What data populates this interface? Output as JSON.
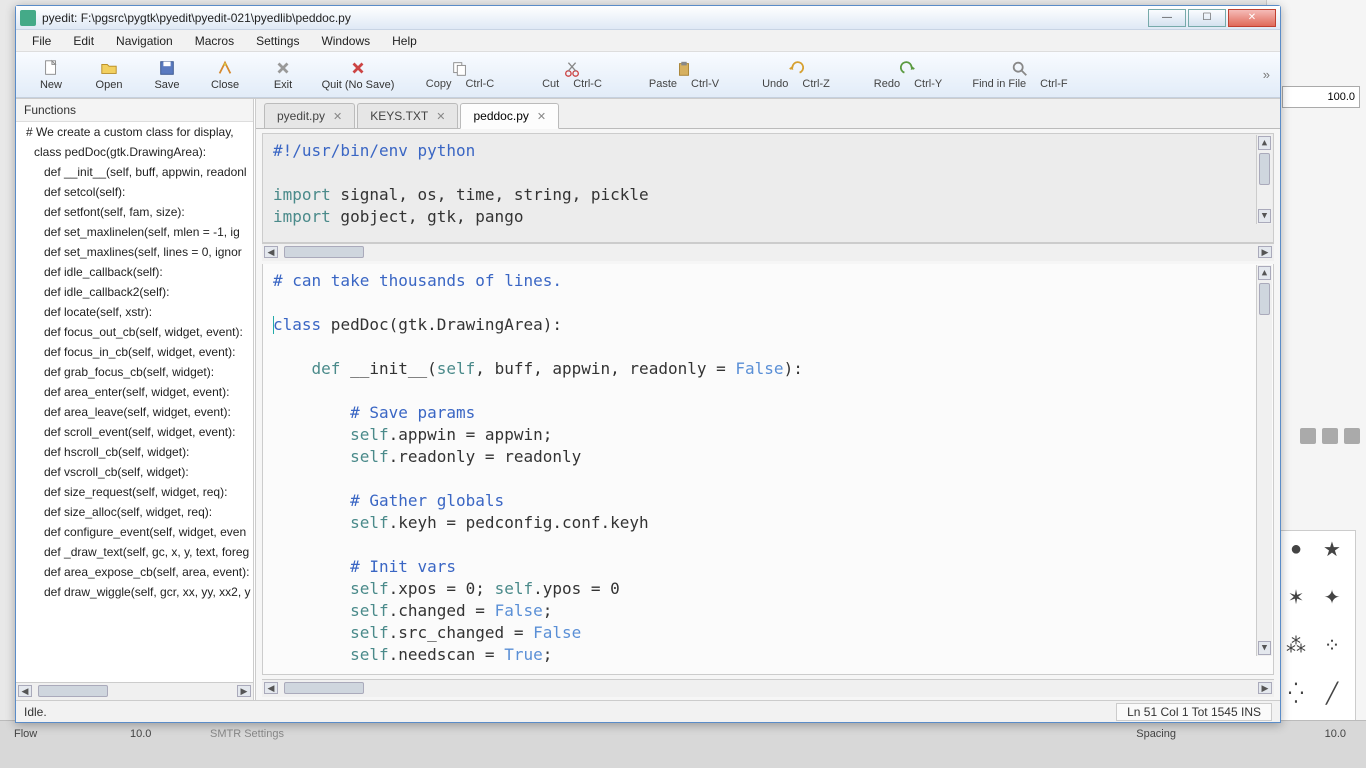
{
  "window": {
    "title": "pyedit: F:\\pgsrc\\pygtk\\pyedit\\pyedit-021\\pyedlib\\peddoc.py"
  },
  "menu": [
    "File",
    "Edit",
    "Navigation",
    "Macros",
    "Settings",
    "Windows",
    "Help"
  ],
  "toolbar": [
    {
      "label": "New",
      "shortcut": ""
    },
    {
      "label": "Open",
      "shortcut": ""
    },
    {
      "label": "Save",
      "shortcut": ""
    },
    {
      "label": "Close",
      "shortcut": ""
    },
    {
      "label": "Exit",
      "shortcut": ""
    },
    {
      "label": "Quit  (No Save)",
      "shortcut": ""
    },
    {
      "label": "Copy",
      "shortcut": "Ctrl-C"
    },
    {
      "label": "Cut",
      "shortcut": "Ctrl-C"
    },
    {
      "label": "Paste",
      "shortcut": "Ctrl-V"
    },
    {
      "label": "Undo",
      "shortcut": "Ctrl-Z"
    },
    {
      "label": "Redo",
      "shortcut": "Ctrl-Y"
    },
    {
      "label": "Find in File",
      "shortcut": "Ctrl-F"
    }
  ],
  "sidebar": {
    "title": "Functions",
    "items": [
      {
        "t": "# We create a custom class for display,",
        "l": 1
      },
      {
        "t": "class pedDoc(gtk.DrawingArea):",
        "l": 2
      },
      {
        "t": "def __init__(self, buff, appwin, readonl",
        "l": 3
      },
      {
        "t": "def setcol(self):",
        "l": 3
      },
      {
        "t": "def setfont(self, fam, size):",
        "l": 3
      },
      {
        "t": "def  set_maxlinelen(self, mlen = -1, ig",
        "l": 3
      },
      {
        "t": "def  set_maxlines(self, lines = 0, ignor",
        "l": 3
      },
      {
        "t": "def idle_callback(self):",
        "l": 3
      },
      {
        "t": "def idle_callback2(self):",
        "l": 3
      },
      {
        "t": "def locate(self, xstr):",
        "l": 3
      },
      {
        "t": "def focus_out_cb(self, widget, event):",
        "l": 3
      },
      {
        "t": "def focus_in_cb(self, widget, event):",
        "l": 3
      },
      {
        "t": "def grab_focus_cb(self, widget):",
        "l": 3
      },
      {
        "t": "def area_enter(self, widget, event):",
        "l": 3
      },
      {
        "t": "def area_leave(self, widget, event):",
        "l": 3
      },
      {
        "t": "def scroll_event(self, widget, event):",
        "l": 3
      },
      {
        "t": "def hscroll_cb(self, widget):",
        "l": 3
      },
      {
        "t": "def vscroll_cb(self, widget):",
        "l": 3
      },
      {
        "t": "def size_request(self, widget, req):",
        "l": 3
      },
      {
        "t": "def size_alloc(self, widget, req):",
        "l": 3
      },
      {
        "t": "def configure_event(self, widget, even",
        "l": 3
      },
      {
        "t": "def _draw_text(self, gc, x, y, text, foreg",
        "l": 3
      },
      {
        "t": "def area_expose_cb(self, area, event):",
        "l": 3
      },
      {
        "t": "def draw_wiggle(self, gcr, xx, yy, xx2, y",
        "l": 3
      }
    ]
  },
  "tabs": [
    {
      "label": "pyedit.py",
      "active": false
    },
    {
      "label": "KEYS.TXT",
      "active": false
    },
    {
      "label": "peddoc.py",
      "active": true
    }
  ],
  "code_top": {
    "l1": "#!/usr/bin/env python",
    "l2": "",
    "l3a": "import",
    "l3b": " signal, os, time, string, pickle",
    "l4a": "import",
    "l4b": " gobject, gtk, pango"
  },
  "code_main": {
    "c1": "# can take thousands of lines.",
    "blank": "",
    "c2a": "class",
    "c2b": " pedDoc(gtk.DrawingArea):",
    "c3a": "    ",
    "c3b": "def",
    "c3c": " __init__(",
    "c3d": "self",
    "c3e": ", buff, appwin, readonly = ",
    "c3f": "False",
    "c3g": "):",
    "c4": "        # Save params",
    "c5a": "        ",
    "c5b": "self",
    "c5c": ".appwin = appwin;",
    "c6a": "        ",
    "c6b": "self",
    "c6c": ".readonly = readonly",
    "c7": "        # Gather globals",
    "c8a": "        ",
    "c8b": "self",
    "c8c": ".keyh = pedconfig.conf.keyh",
    "c9": "        # Init vars",
    "c10a": "        ",
    "c10b": "self",
    "c10c": ".xpos = 0; ",
    "c10d": "self",
    "c10e": ".ypos = 0",
    "c11a": "        ",
    "c11b": "self",
    "c11c": ".changed = ",
    "c11d": "False",
    "c11e": ";",
    "c12a": "        ",
    "c12b": "self",
    "c12c": ".src_changed = ",
    "c12d": "False",
    "c13a": "        ",
    "c13b": "self",
    "c13c": ".needscan = ",
    "c13d": "True",
    "c13e": ";"
  },
  "status": {
    "left": "Idle.",
    "right": "Ln 51 Col 1 Tot 1545  INS"
  },
  "bg": {
    "spin_top": "100.0",
    "flow_label": "Flow",
    "flow_val": "10.0",
    "spacing_label": "Spacing",
    "spacing_val": "10.0",
    "smtr": "SMTR Settings"
  }
}
